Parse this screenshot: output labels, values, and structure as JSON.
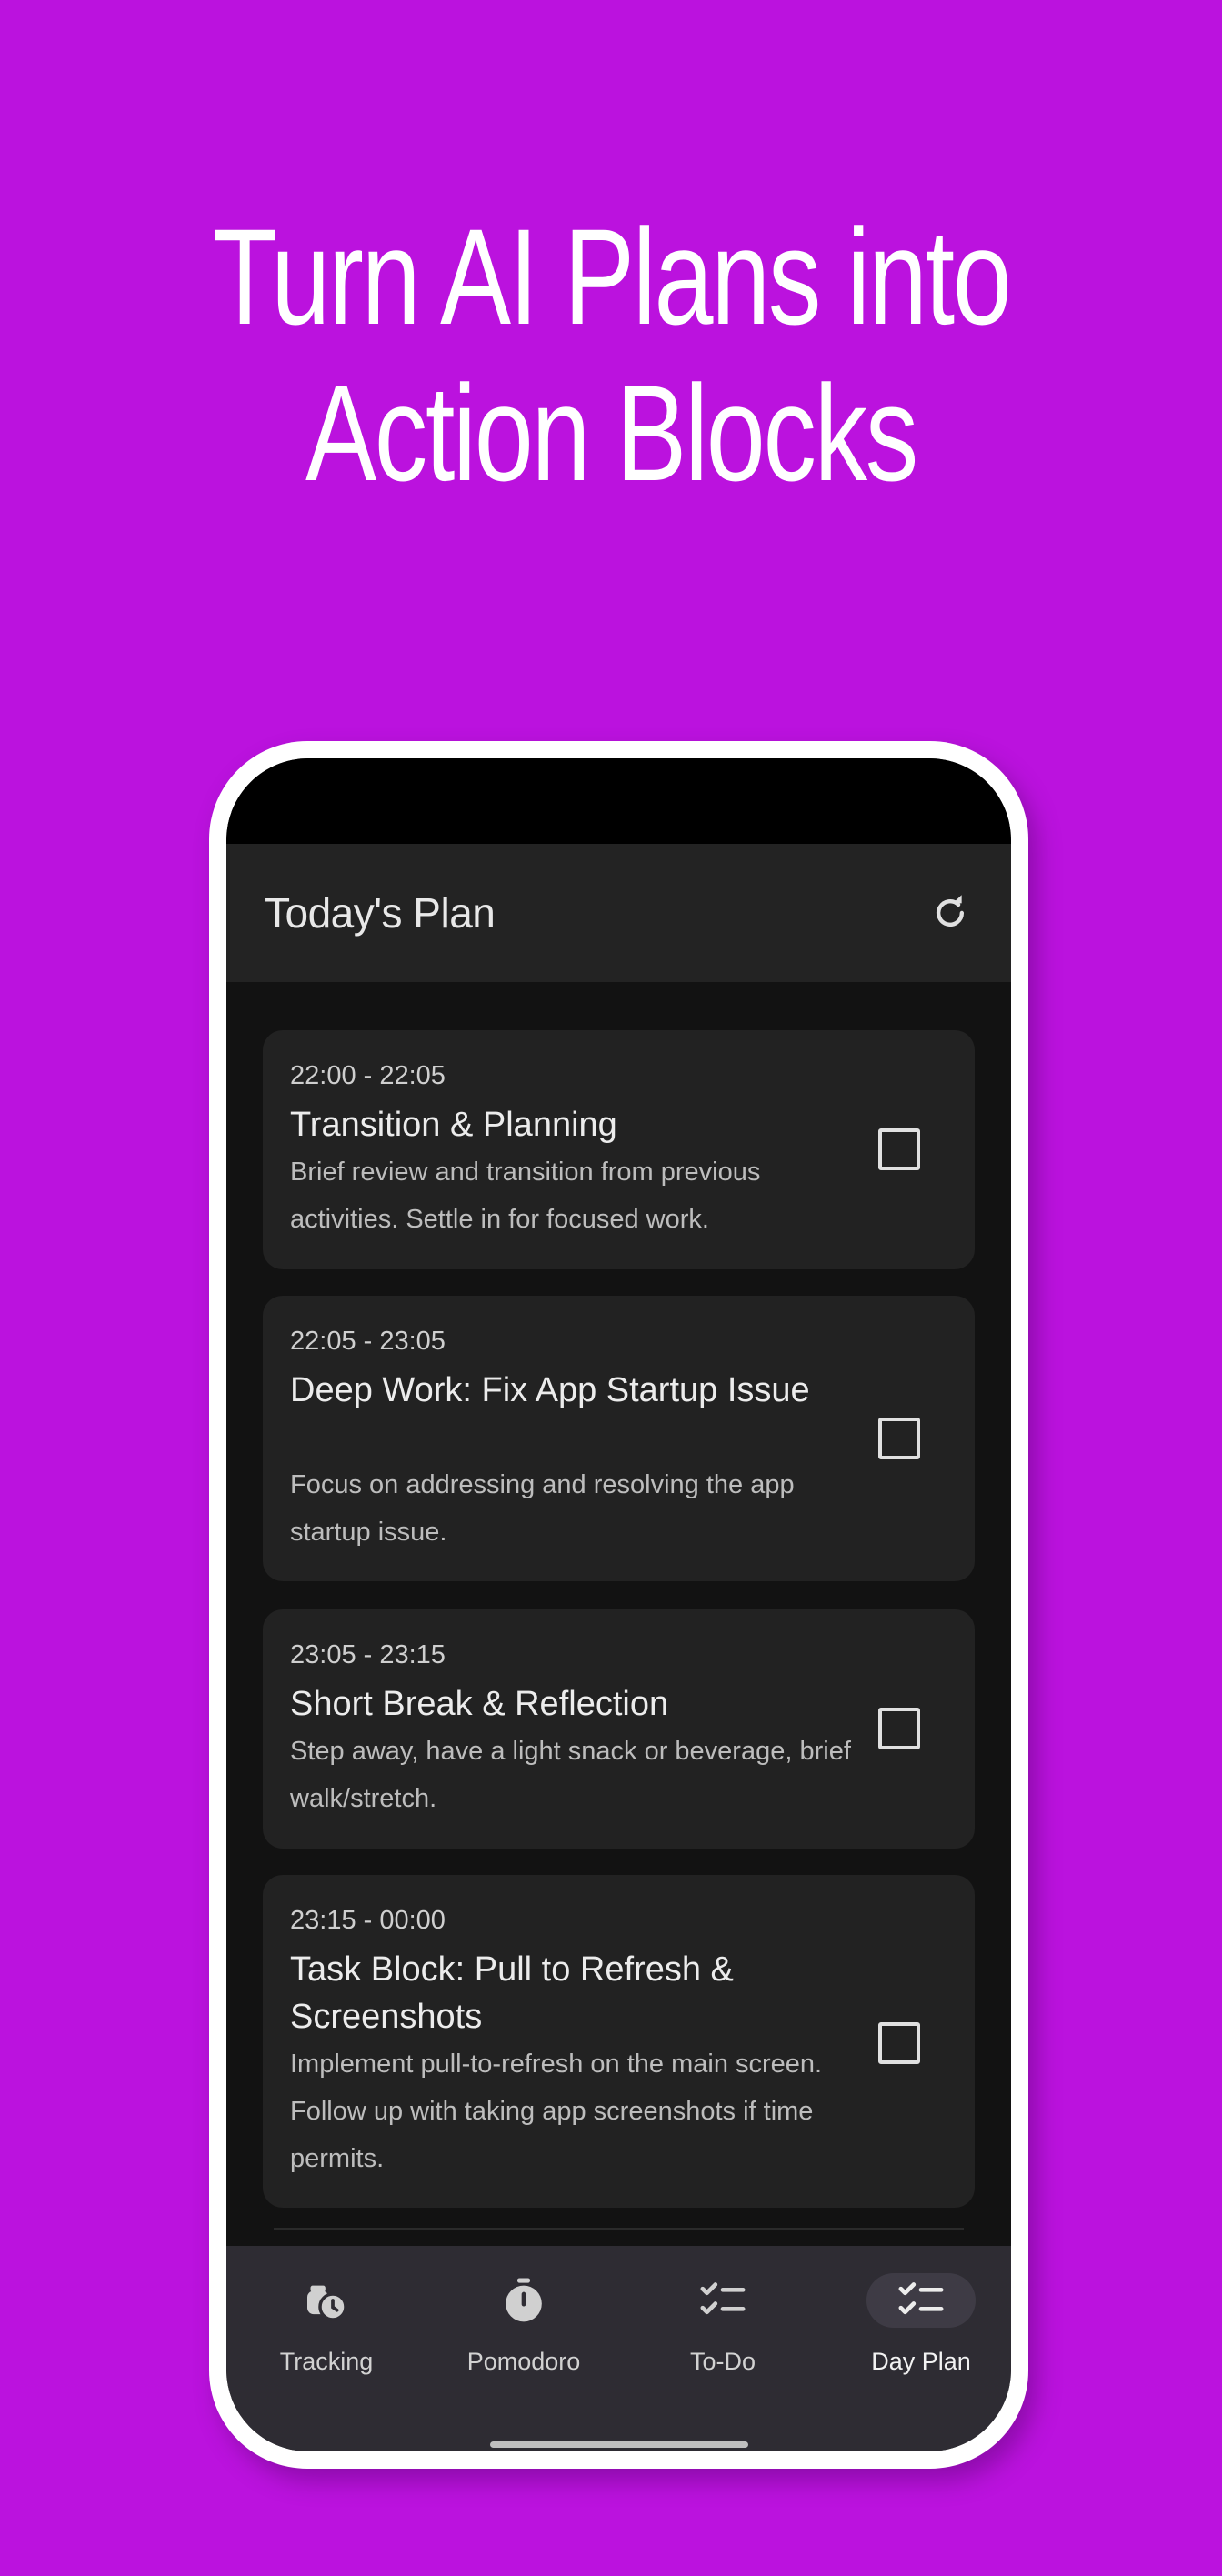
{
  "headline": {
    "line1": "Turn AI Plans into",
    "line2": "Action Blocks"
  },
  "appbar": {
    "title": "Today's Plan",
    "refresh_icon": "refresh-icon"
  },
  "plan_items": [
    {
      "time": "22:00 - 22:05",
      "title": "Transition & Planning",
      "description": "Brief review and transition from previous activities. Settle in for focused work.",
      "checked": false
    },
    {
      "time": "22:05 - 23:05",
      "title": "Deep Work: Fix App Startup Issue",
      "description": "Focus on addressing and resolving the app startup issue.",
      "checked": false
    },
    {
      "time": "23:05 - 23:15",
      "title": "Short Break & Reflection",
      "description": "Step away, have a light snack or beverage, brief walk/stretch.",
      "checked": false
    },
    {
      "time": "23:15 - 00:00",
      "title": "Task Block: Pull to Refresh & Screenshots",
      "description": "Implement pull-to-refresh on the main screen. Follow up with taking app screenshots if time permits.",
      "checked": false
    }
  ],
  "bottom_nav": {
    "items": [
      {
        "label": "Tracking",
        "icon": "stopwatch-clock-icon"
      },
      {
        "label": "Pomodoro",
        "icon": "timer-icon"
      },
      {
        "label": "To-Do",
        "icon": "checklist-icon"
      },
      {
        "label": "Day Plan",
        "icon": "checklist-icon"
      }
    ],
    "active": "Day Plan"
  },
  "colors": {
    "background": "#bb12de",
    "screen": "#121212",
    "card": "#222222",
    "appbar": "#232323",
    "navbar": "#2e2c33"
  }
}
